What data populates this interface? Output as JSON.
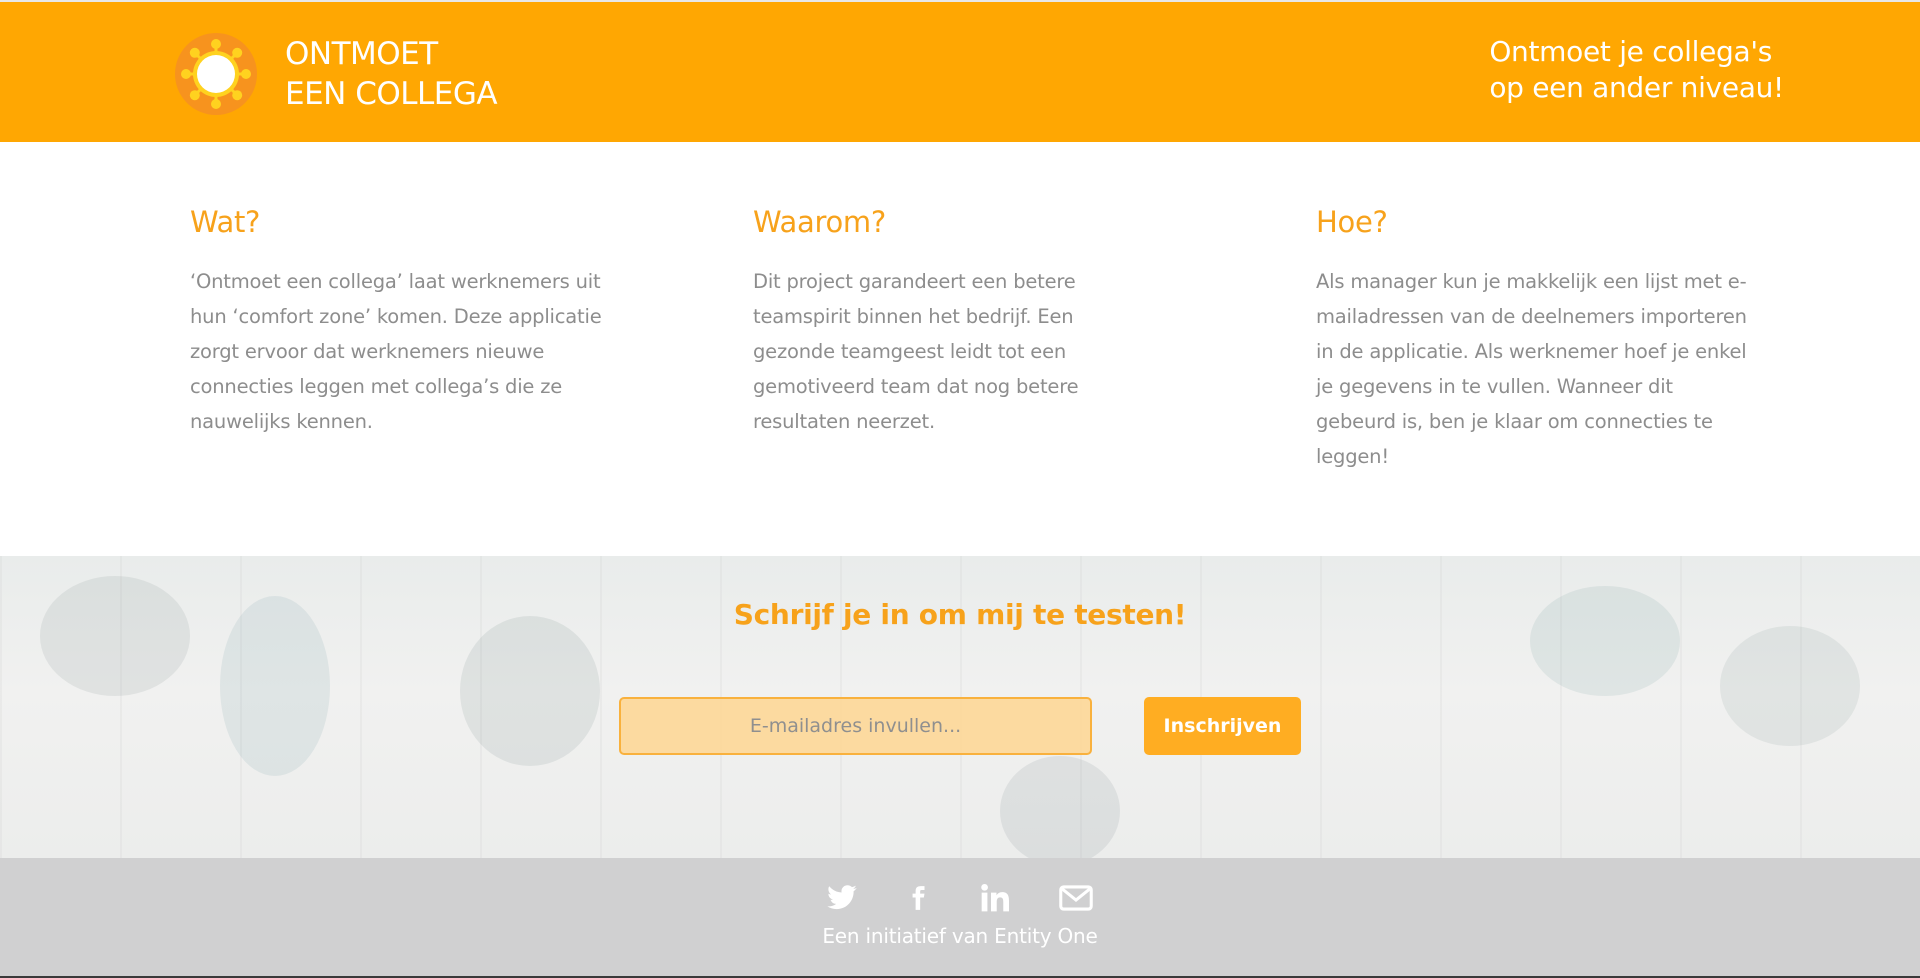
{
  "header": {
    "logo_line1": "ONTMOET",
    "logo_line2": "EEN COLLEGA",
    "tagline_line1": "Ontmoet je collega's",
    "tagline_line2": "op een ander niveau!"
  },
  "columns": [
    {
      "title": "Wat?",
      "text": "‘Ontmoet een collega’ laat werknemers uit hun ‘comfort zone’ komen. Deze applicatie zorgt ervoor dat werknemers nieuwe connecties leggen met collega’s die ze nauwelijks kennen."
    },
    {
      "title": "Waarom?",
      "text": "Dit project garandeert een betere teamspirit binnen het bedrijf. Een gezonde teamgeest leidt tot een gemotiveerd team dat nog betere resultaten neerzet."
    },
    {
      "title": "Hoe?",
      "text": "Als manager kun je makkelijk een lijst met e-mailadressen van de deelnemers importeren in de applicatie. Als werknemer hoef je enkel je gegevens in te vullen. Wanneer dit gebeurd is, ben je klaar om connecties te leggen!"
    }
  ],
  "signup": {
    "title": "Schrijf je in om mij te testen!",
    "email_placeholder": "E-mailadres invullen...",
    "button_label": "Inschrijven"
  },
  "footer": {
    "social_icons": [
      "twitter-icon",
      "facebook-icon",
      "linkedin-icon",
      "mail-icon"
    ],
    "text": "Een initiatief van Entity One"
  },
  "colors": {
    "brand_orange": "#ffa702",
    "heading_orange": "#f7a21b",
    "body_gray": "#8d8d8d",
    "footer_gray": "#cdcecf"
  }
}
